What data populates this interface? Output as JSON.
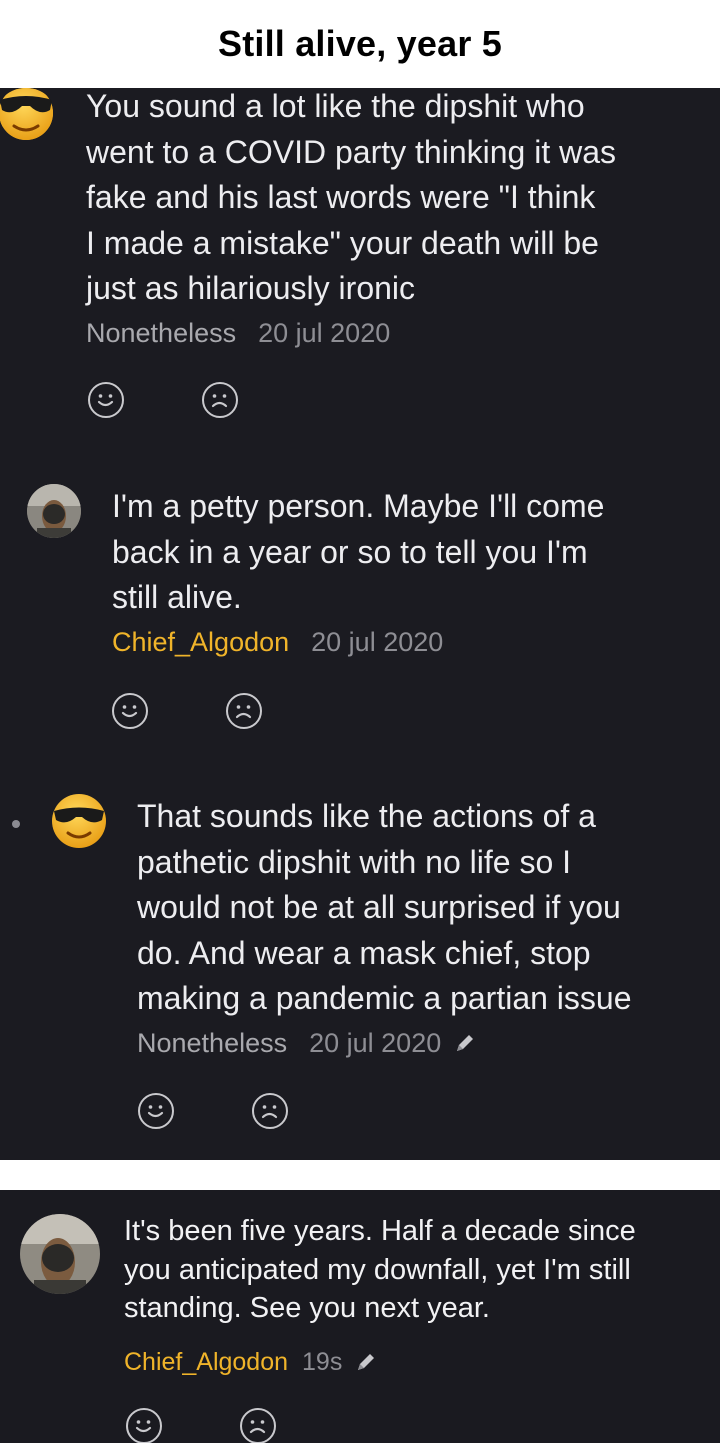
{
  "header": {
    "title": "Still alive, year 5"
  },
  "comments": [
    {
      "lines": [
        "You sound a lot like the dipshit who",
        "went to a COVID party thinking it was",
        "fake and his last words were \"I think",
        "I made a mistake\" your death will be",
        "just as hilariously ironic"
      ],
      "author": "Nonetheless",
      "date": "20 jul 2020",
      "avatar_icon": "sunglasses-emoji-icon"
    },
    {
      "lines": [
        "I'm a petty person. Maybe I'll come",
        "back in a year or so to tell you I'm",
        "still alive."
      ],
      "author": "Chief_Algodon",
      "date": "20 jul 2020",
      "avatar_icon": "user-photo-avatar"
    },
    {
      "lines": [
        "That sounds like the actions of a",
        "pathetic dipshit with no life so I",
        "would not be at all surprised if you",
        "do. And wear a mask chief, stop",
        "making a pandemic a partian issue"
      ],
      "author": "Nonetheless",
      "date": "20 jul 2020",
      "edited_icon": "pencil-icon",
      "avatar_icon": "sunglasses-emoji-icon"
    },
    {
      "lines": [
        "It's been five years. Half a decade since",
        "you anticipated my downfall, yet I'm still",
        "standing. See you next year."
      ],
      "author": "Chief_Algodon",
      "date": "19s",
      "edited_icon": "pencil-icon",
      "avatar_icon": "user-photo-avatar"
    }
  ],
  "reactions": {
    "like_icon": "smiley-face-icon",
    "dislike_icon": "sad-face-icon"
  },
  "colors": {
    "panel_bg": "#1b1b21",
    "text": "#ededf0",
    "author_gray": "#a9a9ae",
    "author_gold": "#f0b42a",
    "date_gray": "#8e8e94"
  }
}
